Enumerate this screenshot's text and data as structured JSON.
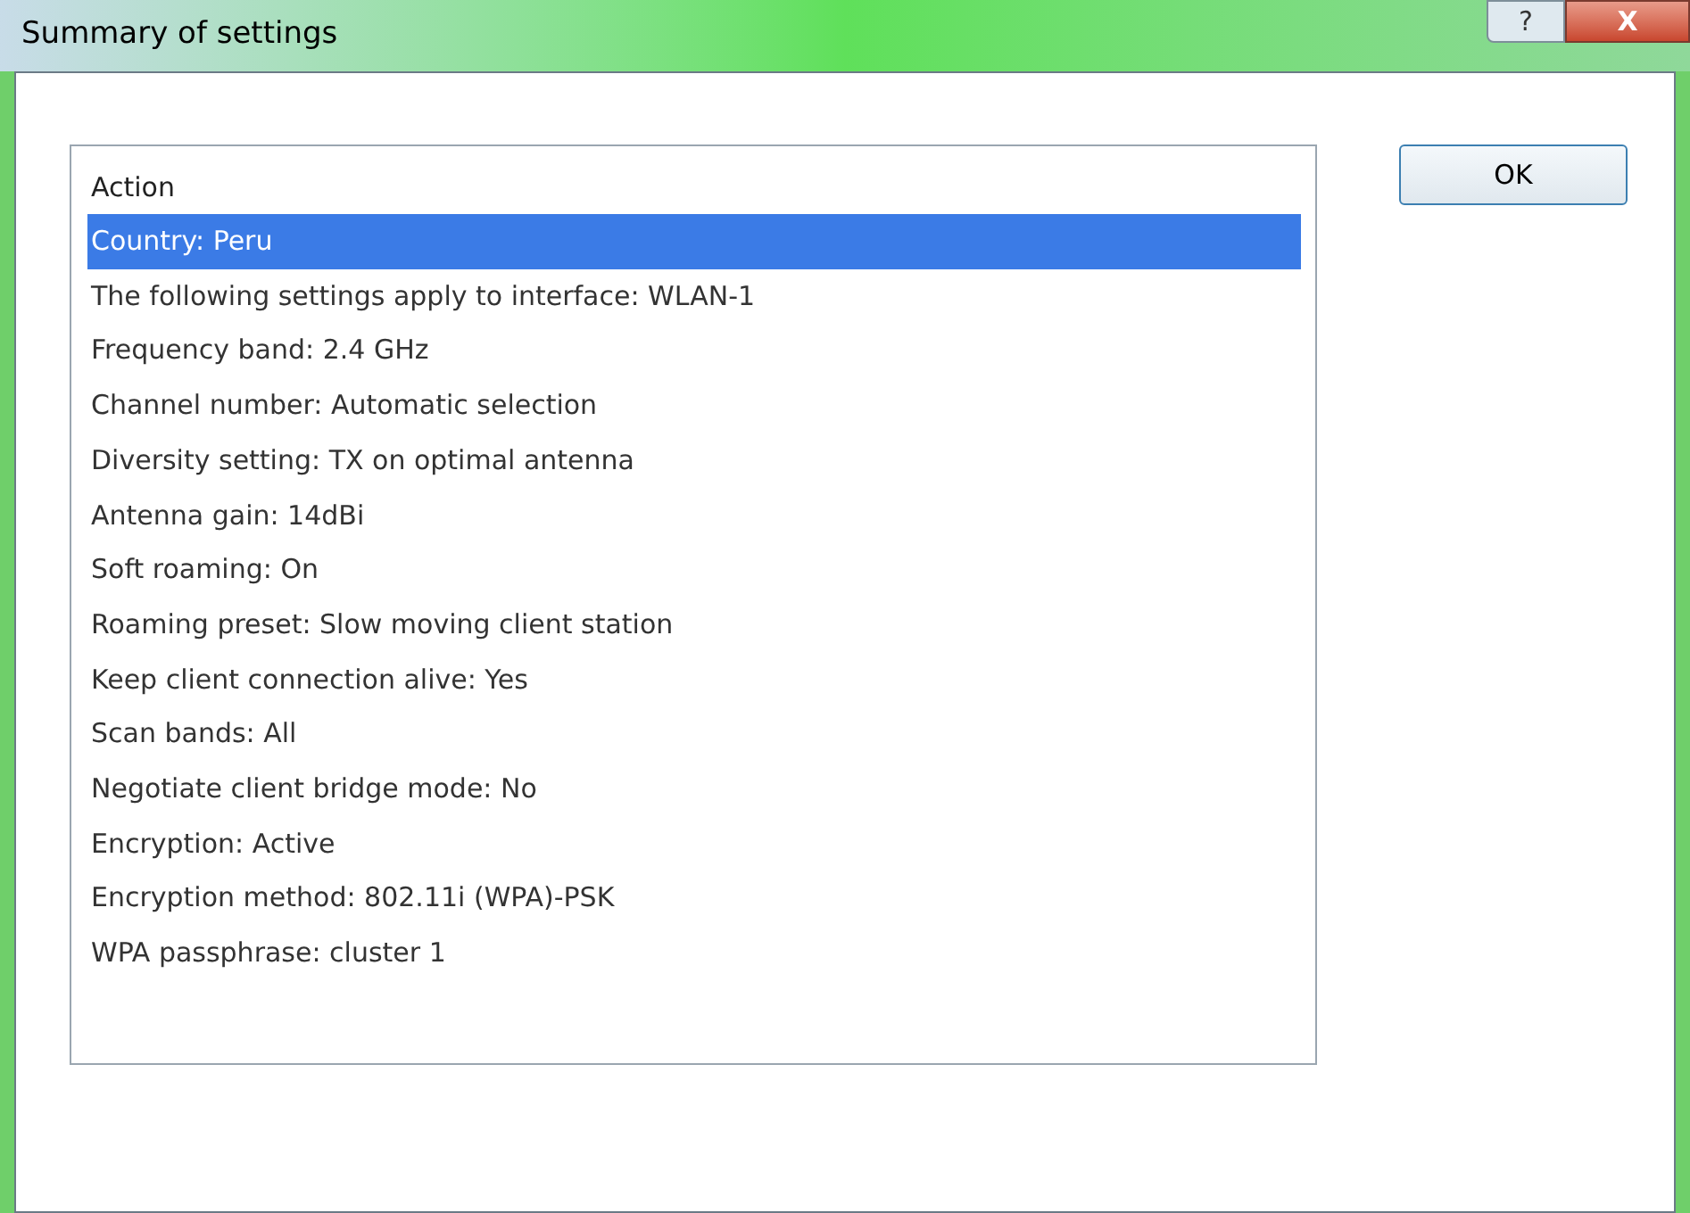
{
  "window": {
    "title": "Summary of settings"
  },
  "title_buttons": [
    {
      "kind": "help",
      "label": "?"
    },
    {
      "kind": "close",
      "label": "X"
    }
  ],
  "list": {
    "header": "Action",
    "items": [
      {
        "label": "Country: Peru",
        "selected": true
      },
      {
        "label": "The following settings apply to interface: WLAN-1",
        "selected": false
      },
      {
        "label": "Frequency band: 2.4 GHz",
        "selected": false
      },
      {
        "label": "Channel number: Automatic selection",
        "selected": false
      },
      {
        "label": "Diversity setting: TX on optimal antenna",
        "selected": false
      },
      {
        "label": "Antenna gain: 14dBi",
        "selected": false
      },
      {
        "label": "Soft roaming: On",
        "selected": false
      },
      {
        "label": "Roaming preset: Slow moving client station",
        "selected": false
      },
      {
        "label": "Keep client connection alive: Yes",
        "selected": false
      },
      {
        "label": "Scan bands: All",
        "selected": false
      },
      {
        "label": "Negotiate client bridge mode: No",
        "selected": false
      },
      {
        "label": "Encryption: Active",
        "selected": false
      },
      {
        "label": "Encryption method: 802.11i (WPA)-PSK",
        "selected": false
      },
      {
        "label": "WPA passphrase: cluster 1",
        "selected": false
      }
    ]
  },
  "buttons": [
    "OK"
  ]
}
